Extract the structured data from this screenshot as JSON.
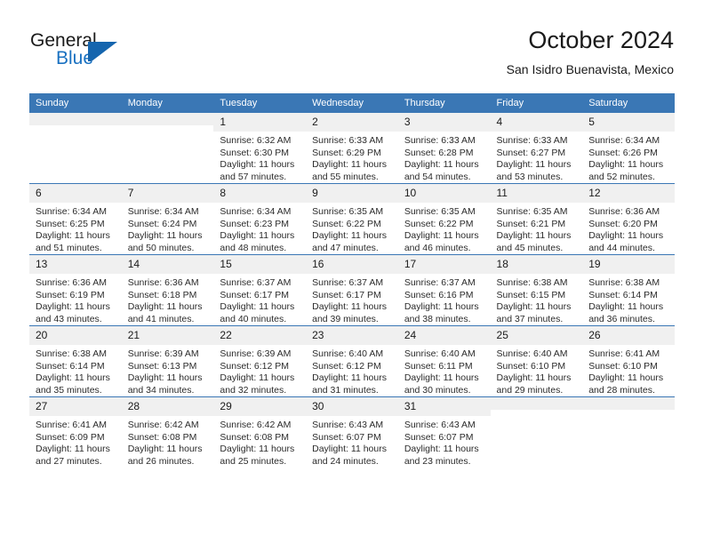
{
  "brand": {
    "name_top": "General",
    "name_bottom": "Blue",
    "accent_color": "#1565ae"
  },
  "header": {
    "title": "October 2024",
    "subtitle": "San Isidro Buenavista, Mexico"
  },
  "theme": {
    "header_bar_color": "#3a77b5",
    "daynum_band_color": "#f0f0f0",
    "text_color": "#1a1a1a"
  },
  "labels": {
    "sunrise_prefix": "Sunrise:",
    "sunset_prefix": "Sunset:",
    "daylight_prefix": "Daylight:"
  },
  "weekdays": [
    "Sunday",
    "Monday",
    "Tuesday",
    "Wednesday",
    "Thursday",
    "Friday",
    "Saturday"
  ],
  "weeks": [
    [
      {
        "day": "",
        "empty": true
      },
      {
        "day": "",
        "empty": true
      },
      {
        "day": "1",
        "sunrise": "Sunrise: 6:32 AM",
        "sunset": "Sunset: 6:30 PM",
        "daylight_line1": "Daylight: 11 hours",
        "daylight_line2": "and 57 minutes."
      },
      {
        "day": "2",
        "sunrise": "Sunrise: 6:33 AM",
        "sunset": "Sunset: 6:29 PM",
        "daylight_line1": "Daylight: 11 hours",
        "daylight_line2": "and 55 minutes."
      },
      {
        "day": "3",
        "sunrise": "Sunrise: 6:33 AM",
        "sunset": "Sunset: 6:28 PM",
        "daylight_line1": "Daylight: 11 hours",
        "daylight_line2": "and 54 minutes."
      },
      {
        "day": "4",
        "sunrise": "Sunrise: 6:33 AM",
        "sunset": "Sunset: 6:27 PM",
        "daylight_line1": "Daylight: 11 hours",
        "daylight_line2": "and 53 minutes."
      },
      {
        "day": "5",
        "sunrise": "Sunrise: 6:34 AM",
        "sunset": "Sunset: 6:26 PM",
        "daylight_line1": "Daylight: 11 hours",
        "daylight_line2": "and 52 minutes."
      }
    ],
    [
      {
        "day": "6",
        "sunrise": "Sunrise: 6:34 AM",
        "sunset": "Sunset: 6:25 PM",
        "daylight_line1": "Daylight: 11 hours",
        "daylight_line2": "and 51 minutes."
      },
      {
        "day": "7",
        "sunrise": "Sunrise: 6:34 AM",
        "sunset": "Sunset: 6:24 PM",
        "daylight_line1": "Daylight: 11 hours",
        "daylight_line2": "and 50 minutes."
      },
      {
        "day": "8",
        "sunrise": "Sunrise: 6:34 AM",
        "sunset": "Sunset: 6:23 PM",
        "daylight_line1": "Daylight: 11 hours",
        "daylight_line2": "and 48 minutes."
      },
      {
        "day": "9",
        "sunrise": "Sunrise: 6:35 AM",
        "sunset": "Sunset: 6:22 PM",
        "daylight_line1": "Daylight: 11 hours",
        "daylight_line2": "and 47 minutes."
      },
      {
        "day": "10",
        "sunrise": "Sunrise: 6:35 AM",
        "sunset": "Sunset: 6:22 PM",
        "daylight_line1": "Daylight: 11 hours",
        "daylight_line2": "and 46 minutes."
      },
      {
        "day": "11",
        "sunrise": "Sunrise: 6:35 AM",
        "sunset": "Sunset: 6:21 PM",
        "daylight_line1": "Daylight: 11 hours",
        "daylight_line2": "and 45 minutes."
      },
      {
        "day": "12",
        "sunrise": "Sunrise: 6:36 AM",
        "sunset": "Sunset: 6:20 PM",
        "daylight_line1": "Daylight: 11 hours",
        "daylight_line2": "and 44 minutes."
      }
    ],
    [
      {
        "day": "13",
        "sunrise": "Sunrise: 6:36 AM",
        "sunset": "Sunset: 6:19 PM",
        "daylight_line1": "Daylight: 11 hours",
        "daylight_line2": "and 43 minutes."
      },
      {
        "day": "14",
        "sunrise": "Sunrise: 6:36 AM",
        "sunset": "Sunset: 6:18 PM",
        "daylight_line1": "Daylight: 11 hours",
        "daylight_line2": "and 41 minutes."
      },
      {
        "day": "15",
        "sunrise": "Sunrise: 6:37 AM",
        "sunset": "Sunset: 6:17 PM",
        "daylight_line1": "Daylight: 11 hours",
        "daylight_line2": "and 40 minutes."
      },
      {
        "day": "16",
        "sunrise": "Sunrise: 6:37 AM",
        "sunset": "Sunset: 6:17 PM",
        "daylight_line1": "Daylight: 11 hours",
        "daylight_line2": "and 39 minutes."
      },
      {
        "day": "17",
        "sunrise": "Sunrise: 6:37 AM",
        "sunset": "Sunset: 6:16 PM",
        "daylight_line1": "Daylight: 11 hours",
        "daylight_line2": "and 38 minutes."
      },
      {
        "day": "18",
        "sunrise": "Sunrise: 6:38 AM",
        "sunset": "Sunset: 6:15 PM",
        "daylight_line1": "Daylight: 11 hours",
        "daylight_line2": "and 37 minutes."
      },
      {
        "day": "19",
        "sunrise": "Sunrise: 6:38 AM",
        "sunset": "Sunset: 6:14 PM",
        "daylight_line1": "Daylight: 11 hours",
        "daylight_line2": "and 36 minutes."
      }
    ],
    [
      {
        "day": "20",
        "sunrise": "Sunrise: 6:38 AM",
        "sunset": "Sunset: 6:14 PM",
        "daylight_line1": "Daylight: 11 hours",
        "daylight_line2": "and 35 minutes."
      },
      {
        "day": "21",
        "sunrise": "Sunrise: 6:39 AM",
        "sunset": "Sunset: 6:13 PM",
        "daylight_line1": "Daylight: 11 hours",
        "daylight_line2": "and 34 minutes."
      },
      {
        "day": "22",
        "sunrise": "Sunrise: 6:39 AM",
        "sunset": "Sunset: 6:12 PM",
        "daylight_line1": "Daylight: 11 hours",
        "daylight_line2": "and 32 minutes."
      },
      {
        "day": "23",
        "sunrise": "Sunrise: 6:40 AM",
        "sunset": "Sunset: 6:12 PM",
        "daylight_line1": "Daylight: 11 hours",
        "daylight_line2": "and 31 minutes."
      },
      {
        "day": "24",
        "sunrise": "Sunrise: 6:40 AM",
        "sunset": "Sunset: 6:11 PM",
        "daylight_line1": "Daylight: 11 hours",
        "daylight_line2": "and 30 minutes."
      },
      {
        "day": "25",
        "sunrise": "Sunrise: 6:40 AM",
        "sunset": "Sunset: 6:10 PM",
        "daylight_line1": "Daylight: 11 hours",
        "daylight_line2": "and 29 minutes."
      },
      {
        "day": "26",
        "sunrise": "Sunrise: 6:41 AM",
        "sunset": "Sunset: 6:10 PM",
        "daylight_line1": "Daylight: 11 hours",
        "daylight_line2": "and 28 minutes."
      }
    ],
    [
      {
        "day": "27",
        "sunrise": "Sunrise: 6:41 AM",
        "sunset": "Sunset: 6:09 PM",
        "daylight_line1": "Daylight: 11 hours",
        "daylight_line2": "and 27 minutes."
      },
      {
        "day": "28",
        "sunrise": "Sunrise: 6:42 AM",
        "sunset": "Sunset: 6:08 PM",
        "daylight_line1": "Daylight: 11 hours",
        "daylight_line2": "and 26 minutes."
      },
      {
        "day": "29",
        "sunrise": "Sunrise: 6:42 AM",
        "sunset": "Sunset: 6:08 PM",
        "daylight_line1": "Daylight: 11 hours",
        "daylight_line2": "and 25 minutes."
      },
      {
        "day": "30",
        "sunrise": "Sunrise: 6:43 AM",
        "sunset": "Sunset: 6:07 PM",
        "daylight_line1": "Daylight: 11 hours",
        "daylight_line2": "and 24 minutes."
      },
      {
        "day": "31",
        "sunrise": "Sunrise: 6:43 AM",
        "sunset": "Sunset: 6:07 PM",
        "daylight_line1": "Daylight: 11 hours",
        "daylight_line2": "and 23 minutes."
      },
      {
        "day": "",
        "empty": true
      },
      {
        "day": "",
        "empty": true
      }
    ]
  ]
}
